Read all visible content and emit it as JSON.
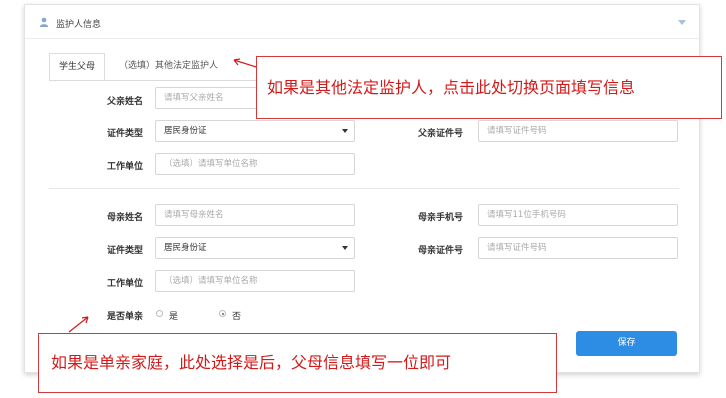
{
  "header": {
    "title": "监护人信息"
  },
  "tabs": [
    {
      "label": "学生父母"
    },
    {
      "label": "（选填）其他法定监护人"
    }
  ],
  "father": {
    "name_label": "父亲姓名",
    "name_placeholder": "请填写父亲姓名",
    "idtype_label": "证件类型",
    "idtype_value": "居民身份证",
    "idno_label": "父亲证件号",
    "idno_placeholder": "请填写证件号码",
    "work_label": "工作单位",
    "work_placeholder": "（选填）请填写单位名称"
  },
  "mother": {
    "name_label": "母亲姓名",
    "name_placeholder": "请填写母亲姓名",
    "phone_label": "母亲手机号",
    "phone_placeholder": "请填写11位手机号码",
    "idtype_label": "证件类型",
    "idtype_value": "居民身份证",
    "idno_label": "母亲证件号",
    "idno_placeholder": "请填写证件号码",
    "work_label": "工作单位",
    "work_placeholder": "（选填）请填写单位名称"
  },
  "single_parent": {
    "label": "是否单亲",
    "yes": "是",
    "no": "否",
    "selected": "否"
  },
  "save_label": "保存",
  "annotations": {
    "tab_hint": "如果是其他法定监护人，点击此处切换页面填写信息",
    "single_hint": "如果是单亲家庭，此处选择是后，父母信息填写一位即可"
  },
  "colors": {
    "accent": "#2d8ce3",
    "annotation": "#d21a1a"
  }
}
